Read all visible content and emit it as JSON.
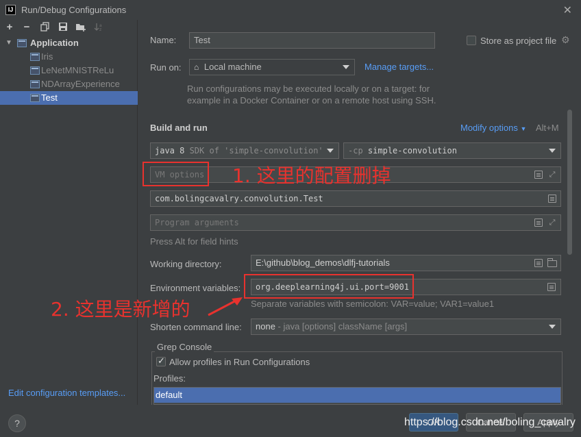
{
  "window": {
    "title": "Run/Debug Configurations",
    "icon_label": "IJ"
  },
  "toolbar": {
    "icons": [
      "add-icon",
      "remove-icon",
      "copy-icon",
      "save-icon",
      "new-folder-icon",
      "sort-icon"
    ]
  },
  "tree": {
    "group": "Application",
    "items": [
      {
        "label": "Iris"
      },
      {
        "label": "LeNetMNISTReLu"
      },
      {
        "label": "NDArrayExperience"
      },
      {
        "label": "Test"
      }
    ],
    "selected": "Test"
  },
  "left_footer": {
    "edit_templates": "Edit configuration templates..."
  },
  "form": {
    "name_label": "Name:",
    "name_value": "Test",
    "store_label": "Store as project file",
    "store_checked": false,
    "run_on_label": "Run on:",
    "run_on_value": "Local machine",
    "manage_targets": "Manage targets...",
    "run_hint_1": "Run configurations may be executed locally or on a target: for",
    "run_hint_2": "example in a Docker Container or on a remote host using SSH.",
    "build_run": "Build and run",
    "modify_options": "Modify options",
    "modify_shortcut": "Alt+M",
    "jdk_value": "java 8",
    "jdk_rest": " SDK of 'simple-convolution'",
    "cp_prefix": "-cp",
    "cp_value": "simple-convolution",
    "vm_options_placeholder": "VM options",
    "main_class": "com.bolingcavalry.convolution.Test",
    "program_args_placeholder": "Program arguments",
    "field_hints": "Press Alt for field hints",
    "workdir_label": "Working directory:",
    "workdir_value": "E:\\github\\blog_demos\\dlfj-tutorials",
    "env_label": "Environment variables:",
    "env_value": "org.deeplearning4j.ui.port=9001",
    "env_hint": "Separate variables with semicolon: VAR=value; VAR1=value1",
    "shorten_label": "Shorten command line:",
    "shorten_value": "none",
    "shorten_rest": " - java [options] className [args]",
    "grep_title": "Grep Console",
    "allow_profiles": "Allow profiles in Run Configurations",
    "allow_checked": true,
    "profiles_label": "Profiles:",
    "profile_default": "default"
  },
  "annotations": {
    "note_1": "1. 这里的配置删掉",
    "note_2": "2. 这里是新增的"
  },
  "buttons": {
    "help": "?",
    "ok": "OK",
    "cancel": "Cancel",
    "apply": "Apply"
  },
  "watermark": "https://blog.csdn.net/boling_cavalry",
  "colors": {
    "background": "#3c3f41",
    "selection": "#4b6eaf",
    "link": "#589df6",
    "annotation": "#e8322e",
    "field": "#45494a"
  }
}
